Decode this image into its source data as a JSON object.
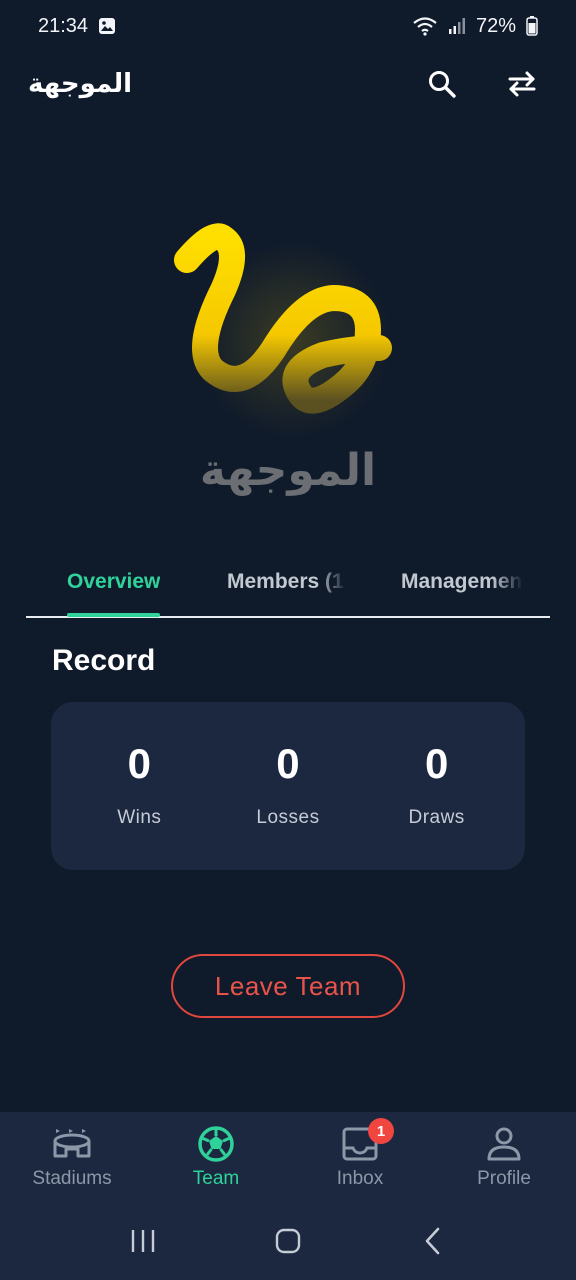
{
  "status_bar": {
    "time": "21:34",
    "battery": "72%",
    "icons": [
      "gallery-icon",
      "wifi-icon",
      "signal-icon",
      "battery-icon"
    ]
  },
  "app_bar": {
    "title": "الموجهة",
    "actions": [
      "search-icon",
      "swap-icon"
    ]
  },
  "hero": {
    "logo_text": "الموجهة",
    "logo_color": "#ffd500"
  },
  "tabs": [
    {
      "label": "Overview",
      "active": true
    },
    {
      "label": "Members (1",
      "active": false
    },
    {
      "label": "Managemen",
      "active": false
    }
  ],
  "record": {
    "title": "Record",
    "stats": [
      {
        "value": "0",
        "label": "Wins"
      },
      {
        "value": "0",
        "label": "Losses"
      },
      {
        "value": "0",
        "label": "Draws"
      }
    ]
  },
  "leave_button": {
    "label": "Leave Team"
  },
  "bottom_nav": [
    {
      "label": "Stadiums",
      "icon": "stadium-icon",
      "active": false
    },
    {
      "label": "Team",
      "icon": "soccer-ball-icon",
      "active": true
    },
    {
      "label": "Inbox",
      "icon": "inbox-icon",
      "active": false,
      "badge": "1"
    },
    {
      "label": "Profile",
      "icon": "profile-icon",
      "active": false
    }
  ],
  "colors": {
    "background": "#0f1a2b",
    "card": "#1c2740",
    "accent": "#2fd39a",
    "danger": "#e8534a"
  }
}
